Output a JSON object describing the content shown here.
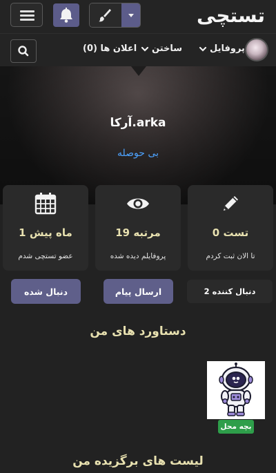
{
  "header": {
    "logo_text": "تستچی",
    "icons": {
      "menu": "hamburger-icon",
      "bell": "bell-icon",
      "theme": "paintbrush-icon",
      "caret": "caret-down-icon"
    }
  },
  "nav": {
    "profile_label": "پروفایل",
    "build_label": "ساختن",
    "notifications_label": "اعلان ها (0)"
  },
  "profile": {
    "username": "آرکا.arka",
    "bio": "بی حوصله"
  },
  "stats": [
    {
      "value": "0 تست",
      "label": "تا الان ثبت کردم",
      "icon": "pencil-icon"
    },
    {
      "value": "19 مرتبه",
      "label": "پروفایلم دیده شده",
      "icon": "eye-icon"
    },
    {
      "value": "1 ماه پیش",
      "label": "عضو تستچی شدم",
      "icon": "calendar-icon"
    }
  ],
  "actions": {
    "followers": "2 دنبال کننده",
    "message": "ارسال پیام",
    "following": "دنبال شده"
  },
  "achievements": {
    "title": "دستاورد های من",
    "badge": "بچه محل"
  },
  "favorites": {
    "title": "لیست های برگزیده من"
  },
  "colors": {
    "background": "#222222",
    "card": "#2a2a2a",
    "accent": "#5f5f8a",
    "gold_text": "#e8e1b0",
    "link": "#4da3ff",
    "badge_green": "#2e9e4a"
  }
}
